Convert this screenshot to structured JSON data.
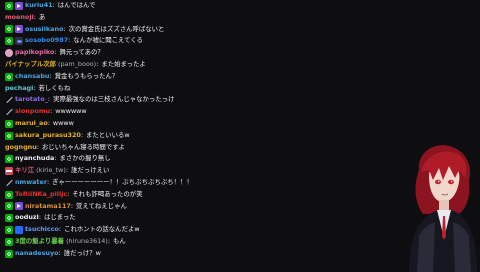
{
  "messages": [
    {
      "badges": [
        "mod",
        "purple"
      ],
      "name": "kuriu41",
      "alt": "",
      "color": "#4aa3df",
      "text": "はんではんで"
    },
    {
      "badges": [],
      "name": "moenoji",
      "alt": "",
      "color": "#e15a7a",
      "text": "あ"
    },
    {
      "badges": [
        "mod",
        "purple"
      ],
      "name": "osusiikano",
      "alt": "",
      "color": "#4aa3df",
      "text": "次の賞金氏はズズさん呼ばないと"
    },
    {
      "badges": [
        "mod",
        "prime"
      ],
      "name": "sosobo0987",
      "alt": "",
      "color": "#2e8be8",
      "text": "なんか嘘に聞こえてくる"
    },
    {
      "badges": [
        "pink"
      ],
      "name": "papikopiko",
      "alt": "",
      "color": "#e66aa6",
      "text": "舞元ってあの？"
    },
    {
      "badges": [],
      "name": "パイナップル次郎",
      "alt": "(pam_booo)",
      "color": "#e3b21f",
      "text": "また始まったよ"
    },
    {
      "badges": [
        "mod"
      ],
      "name": "chansabu",
      "alt": "",
      "color": "#4aa3df",
      "text": "賞金もうもらったん？"
    },
    {
      "badges": [],
      "name": "pechagi",
      "alt": "",
      "color": "#5ec7d9",
      "text": "若しくもね"
    },
    {
      "badges": [
        "sword"
      ],
      "name": "tarotato_",
      "alt": "",
      "color": "#8d6be8",
      "text": "実際最強なのは三枝さんじゃなかったっけ"
    },
    {
      "badges": [
        "sword"
      ],
      "name": "sionpomu",
      "alt": "",
      "color": "#e5302f",
      "text": "wwwwww"
    },
    {
      "badges": [
        "mod"
      ],
      "name": "marui_ao",
      "alt": "",
      "color": "#e3b21f",
      "text": "wwww"
    },
    {
      "badges": [
        "mod"
      ],
      "name": "sakura_purasu320",
      "alt": "",
      "color": "#e3b21f",
      "text": "またといいるw"
    },
    {
      "badges": [],
      "name": "gogngnu",
      "alt": "",
      "color": "#e3b21f",
      "text": "おじいちゃん寝る時間ですよ"
    },
    {
      "badges": [
        "mod"
      ],
      "name": "nyanchuda",
      "alt": "",
      "color": "#efeff1",
      "text": "まさかの握り無し"
    },
    {
      "badges": [
        "gift"
      ],
      "name": "キリ江",
      "alt": "(kirie_tw)",
      "color": "#e15a7a",
      "text": "誰だっけえい"
    },
    {
      "badges": [
        "sword"
      ],
      "name": "nmwater",
      "alt": "",
      "color": "#4aa3df",
      "text": "ぎゃーーーーーーー！！ぶちぶちぶちぶち！！！"
    },
    {
      "badges": [
        "mod"
      ],
      "name": "ToRiiNKa_pilljc",
      "alt": "",
      "color": "#e5302f",
      "text": "それも詐喝あったのが笑"
    },
    {
      "badges": [
        "mod",
        "purple"
      ],
      "name": "niratama117",
      "alt": "",
      "color": "#d9903a",
      "text": "覚えてねえじゃん"
    },
    {
      "badges": [
        "mod"
      ],
      "name": "ooduzi",
      "alt": "",
      "color": "#efeff1",
      "text": "はじまった"
    },
    {
      "badges": [
        "mod",
        "stream"
      ],
      "name": "tsuchicco",
      "alt": "",
      "color": "#5c9cff",
      "text": "これホントの話なんだよw"
    },
    {
      "badges": [
        "mod"
      ],
      "name": "3度の飯より暴着",
      "alt": "(hirune3614)",
      "color": "#6ad24f",
      "text": "もん"
    },
    {
      "badges": [
        "mod"
      ],
      "name": "nanadesuyo",
      "alt": "",
      "color": "#4aa3df",
      "text": "誰だっけ？w"
    }
  ],
  "accent": {
    "mod": "#00ad03",
    "background": "#0e0e10",
    "text": "#efeff1"
  }
}
